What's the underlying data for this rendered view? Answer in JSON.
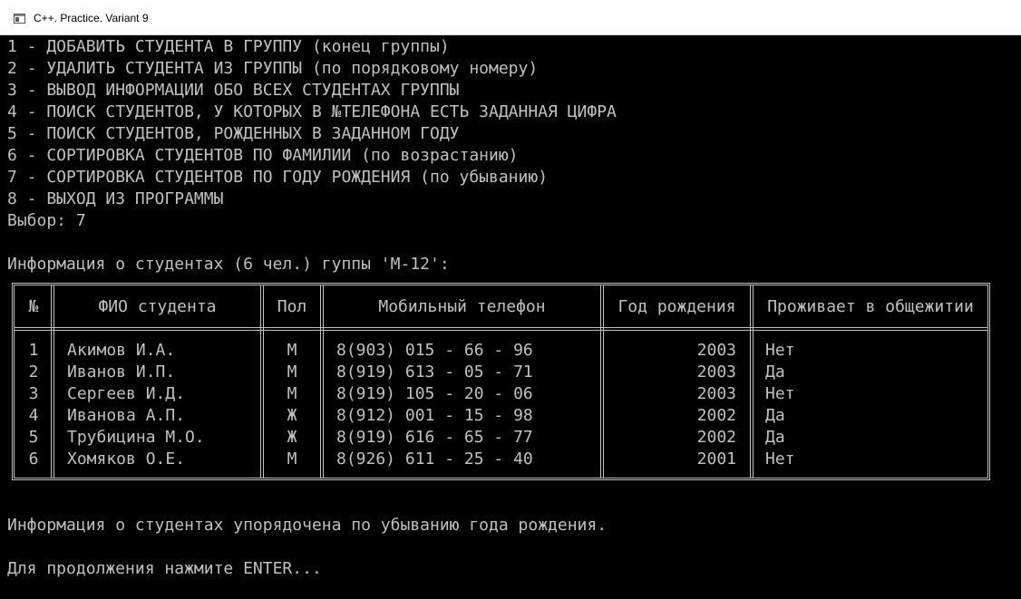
{
  "window": {
    "title": "C++. Practice. Variant 9",
    "icon": "console-window-icon"
  },
  "console": {
    "menu": [
      "1 - ДОБАВИТЬ СТУДЕНТА В ГРУППУ (конец группы)",
      "2 - УДАЛИТЬ СТУДЕНТА ИЗ ГРУППЫ (по порядковому номеру)",
      "3 - ВЫВОД ИНФОРМАЦИИ ОБО ВСЕХ СТУДЕНТАХ ГРУППЫ",
      "4 - ПОИСК СТУДЕНТОВ, У КОТОРЫХ В №ТЕЛЕФОНА ЕСТЬ ЗАДАННАЯ ЦИФРА",
      "5 - ПОИСК СТУДЕНТОВ, РОЖДЕННЫХ В ЗАДАННОМ ГОДУ",
      "6 - СОРТИРОВКА СТУДЕНТОВ ПО ФАМИЛИИ (по возрастанию)",
      "7 - СОРТИРОВКА СТУДЕНТОВ ПО ГОДУ РОЖДЕНИЯ (по убыванию)",
      "8 - ВЫХОД ИЗ ПРОГРАММЫ"
    ],
    "choice_line": "Выбор: 7",
    "info_header": "Информация о студентах (6 чел.) гуппы 'М-12':",
    "table": {
      "headers": [
        "№",
        "ФИО студента",
        "Пол",
        "Мобильный телефон",
        "Год рождения",
        "Проживает в общежитии"
      ],
      "rows": [
        [
          "1",
          "Акимов И.А.",
          "М",
          "8(903) 015 - 66 - 96",
          "2003",
          "Нет"
        ],
        [
          "2",
          "Иванов И.П.",
          "М",
          "8(919) 613 - 05 - 71",
          "2003",
          "Да"
        ],
        [
          "3",
          "Сергеев И.Д.",
          "М",
          "8(919) 105 - 20 - 06",
          "2003",
          "Нет"
        ],
        [
          "4",
          "Иванова А.П.",
          "Ж",
          "8(912) 001 - 15 - 98",
          "2002",
          "Да"
        ],
        [
          "5",
          "Трубицина М.О.",
          "Ж",
          "8(919) 616 - 65 - 77",
          "2002",
          "Да"
        ],
        [
          "6",
          "Хомяков О.Е.",
          "М",
          "8(926) 611 - 25 - 40",
          "2001",
          "Нет"
        ]
      ]
    },
    "sorted_message": "Информация о студентах упорядочена по убыванию года рождения.",
    "continue_prompt": "Для продолжения нажмите ENTER..."
  }
}
